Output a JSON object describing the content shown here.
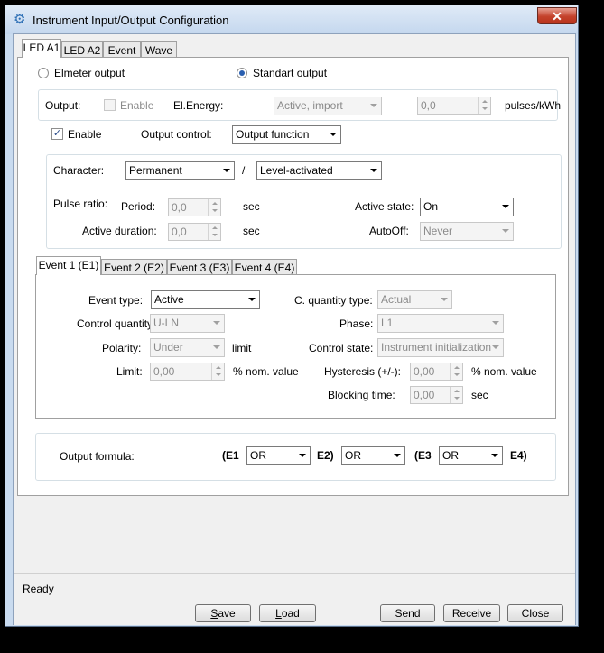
{
  "window": {
    "title": "Instrument Input/Output Configuration",
    "icon": "gears-icon",
    "close_glyph": "✕"
  },
  "main_tabs": [
    {
      "label": "LED A1",
      "active": true
    },
    {
      "label": "LED A2"
    },
    {
      "label": "Event"
    },
    {
      "label": "Wave"
    }
  ],
  "mode": {
    "elmeter_label": "Elmeter output",
    "standart_label": "Standart output",
    "selected": "standart"
  },
  "output_row": {
    "output_label": "Output:",
    "enable_label": "Enable",
    "elenergy_label": "El.Energy:",
    "elenergy_value": "Active, import",
    "pulses_value": "0,0",
    "pulses_unit": "pulses/kWh"
  },
  "control_row": {
    "enable_label": "Enable",
    "enable_checked": true,
    "check_glyph": "✓",
    "output_control_label": "Output control:",
    "output_control_value": "Output function"
  },
  "character": {
    "label": "Character:",
    "value1": "Permanent",
    "separator": "/",
    "value2": "Level-activated",
    "pulse_ratio_label": "Pulse ratio:",
    "period_label": "Period:",
    "period_value": "0,0",
    "period_unit": "sec",
    "active_duration_label": "Active duration:",
    "active_duration_value": "0,0",
    "active_duration_unit": "sec",
    "active_state_label": "Active state:",
    "active_state_value": "On",
    "autooff_label": "AutoOff:",
    "autooff_value": "Never"
  },
  "event_tabs": [
    {
      "label": "Event 1 (E1)",
      "active": true
    },
    {
      "label": "Event 2 (E2)"
    },
    {
      "label": "Event 3 (E3)"
    },
    {
      "label": "Event 4 (E4)"
    }
  ],
  "event": {
    "event_type_label": "Event type:",
    "event_type_value": "Active",
    "cq_type_label": "C. quantity type:",
    "cq_type_value": "Actual",
    "control_quantity_label": "Control quantity:",
    "control_quantity_value": "U-LN",
    "phase_label": "Phase:",
    "phase_value": "L1",
    "polarity_label": "Polarity:",
    "polarity_value": "Under",
    "polarity_unit": "limit",
    "control_state_label": "Control state:",
    "control_state_value": "Instrument initialization",
    "limit_label": "Limit:",
    "limit_value": "0,00",
    "limit_unit": "% nom. value",
    "hysteresis_label": "Hysteresis (+/-):",
    "hysteresis_value": "0,00",
    "hysteresis_unit": "% nom. value",
    "blocking_label": "Blocking time:",
    "blocking_value": "0,00",
    "blocking_unit": "sec"
  },
  "formula": {
    "label": "Output formula:",
    "t1": "(E1",
    "op1": "OR",
    "t2": "E2)",
    "op2": "OR",
    "t3": "(E3",
    "op3": "OR",
    "t4": "E4)"
  },
  "status": {
    "text": "Ready"
  },
  "buttons": {
    "save_pre": "",
    "save_u": "S",
    "save_post": "ave",
    "load_pre": "",
    "load_u": "L",
    "load_post": "oad",
    "send": "Send",
    "receive": "Receive",
    "close": "Close"
  }
}
